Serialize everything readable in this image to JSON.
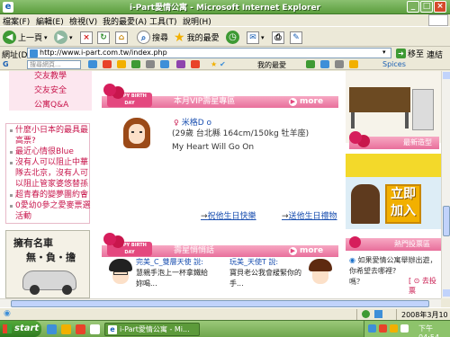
{
  "window": {
    "title": "i-Part愛情公寓 - Microsoft Internet Explorer",
    "app_icon": "e",
    "minimize": "_",
    "maximize": "□",
    "close": "×"
  },
  "menu": {
    "items": [
      "檔案(F)",
      "編輯(E)",
      "檢視(V)",
      "我的最愛(A)",
      "工具(T)",
      "說明(H)"
    ]
  },
  "toolbar": {
    "back_label": "上一頁",
    "search_label": "搜尋",
    "favorites_label": "我的最愛"
  },
  "address": {
    "label": "網址(D)",
    "url": "http://www.i-part.com.tw/index.php",
    "go_label": "移至",
    "links_label": "連結"
  },
  "google_bar": {
    "search_placeholder": "搜尋網頁...",
    "favorites_label": "我的最愛",
    "spices_label": "Spices"
  },
  "left_column": {
    "top_links": [
      "交友教學",
      "交友安全",
      "公寓Q&A"
    ],
    "news": [
      "什麼小日本的最具最",
      "高票?",
      "最近心情很Blue",
      "沒有人可以阻止中華",
      "隊去北京，沒有人可",
      "以阻止管家婆悠替孫",
      "超青春的變夢團約會",
      "0愛幼0參之愛麥票選",
      "活動"
    ],
    "car_ad": {
      "line1": "擁有名車",
      "line2": "無‧負‧擔"
    }
  },
  "center_column": {
    "vip_section": {
      "title": "本月VIP壽星專區",
      "more": "more",
      "tag": "HAPPY BIRTH DAY",
      "member_name": "米格D o",
      "member_info": "(29歲 台北縣 164cm/150kg 牡羊座)",
      "member_message": "My Heart Will Go On",
      "link_send": "祝他生日快樂",
      "link_gift": "送他生日禮物"
    },
    "wish_section": {
      "title": "壽星悄悄話",
      "more": "more",
      "tag": "HAPPY BIRTH DAY",
      "wish1_name": "完美_C_雙層天使 說:",
      "wish1_text1": "慧親手泡上一杯拿鐵給",
      "wish1_text2": "妳喝...",
      "wish2_name": "玩美_天使T 說:",
      "wish2_text1": "寶貝老公我會緩緊你的",
      "wish2_text2": "手..."
    }
  },
  "right_column": {
    "rose_header": "最新造型",
    "join_text": "立即加入",
    "header2": "熱門投票區",
    "question": "如果愛情公寓舉辦出遊，你希望去哪裡?",
    "question_line2": "嗎？",
    "go_label": "[ ⊙ 去投票"
  },
  "status": {
    "datetime": "2008年3月10日"
  },
  "taskbar": {
    "start_label": "start",
    "task_label": "i-Part愛情公寓 - Mi...",
    "time": "下午 04:54"
  }
}
